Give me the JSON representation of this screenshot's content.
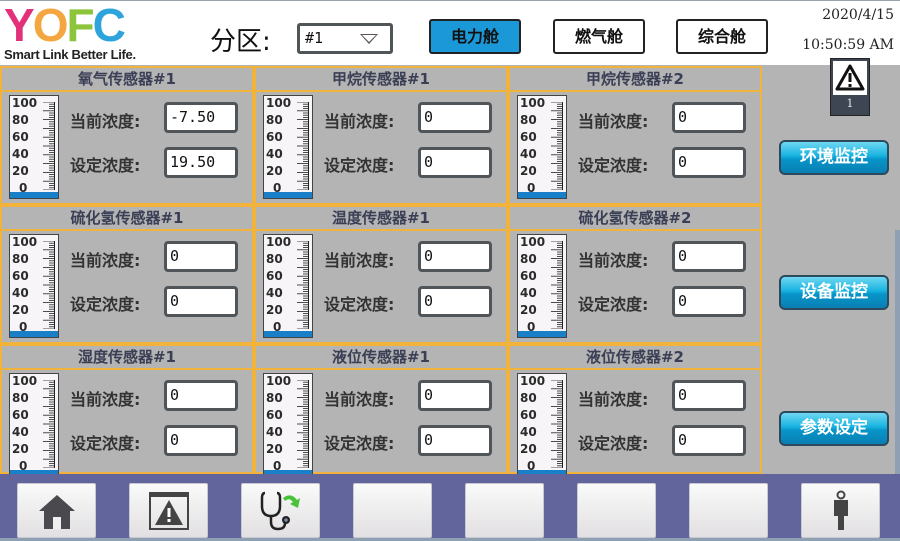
{
  "header": {
    "logo": {
      "letters": [
        {
          "char": "Y",
          "color": "#e2307a"
        },
        {
          "char": "O",
          "color": "#f4a640"
        },
        {
          "char": "F",
          "color": "#8cc43c"
        },
        {
          "char": "C",
          "color": "#2ea4dc"
        }
      ],
      "tagline": "Smart Link Better Life."
    },
    "zone_label": "分区:",
    "zone_select": {
      "value": "#1"
    },
    "cabins": [
      {
        "label": "电力舱",
        "active": true
      },
      {
        "label": "燃气舱",
        "active": false
      },
      {
        "label": "综合舱",
        "active": false
      }
    ],
    "date": "2020/4/15",
    "time": "10:50:59 AM",
    "alarm": {
      "icon": "warning-icon",
      "count": "1"
    }
  },
  "labels": {
    "current": "当前浓度:",
    "setpoint": "设定浓度:"
  },
  "gauge_scale": [
    "100",
    "80",
    "60",
    "40",
    "20",
    "0"
  ],
  "sensors": [
    {
      "title": "氧气传感器#1",
      "current": "-7.50",
      "setpoint": "19.50",
      "level_percent": 0
    },
    {
      "title": "甲烷传感器#1",
      "current": "0",
      "setpoint": "0",
      "level_percent": 0
    },
    {
      "title": "甲烷传感器#2",
      "current": "0",
      "setpoint": "0",
      "level_percent": 0
    },
    {
      "title": "硫化氢传感器#1",
      "current": "0",
      "setpoint": "0",
      "level_percent": 0
    },
    {
      "title": "温度传感器#1",
      "current": "0",
      "setpoint": "0",
      "level_percent": 0
    },
    {
      "title": "硫化氢传感器#2",
      "current": "0",
      "setpoint": "0",
      "level_percent": 0
    },
    {
      "title": "湿度传感器#1",
      "current": "0",
      "setpoint": "0",
      "level_percent": 0
    },
    {
      "title": "液位传感器#1",
      "current": "0",
      "setpoint": "0",
      "level_percent": 0
    },
    {
      "title": "液位传感器#2",
      "current": "0",
      "setpoint": "0",
      "level_percent": 0
    }
  ],
  "side_nav": [
    {
      "label": "环境监控"
    },
    {
      "label": "设备监控"
    },
    {
      "label": "参数设定"
    }
  ],
  "toolbar": [
    {
      "icon": "home-icon"
    },
    {
      "icon": "alarm-window-icon"
    },
    {
      "icon": "stethoscope-icon"
    },
    {
      "icon": ""
    },
    {
      "icon": ""
    },
    {
      "icon": ""
    },
    {
      "icon": ""
    },
    {
      "icon": "user-icon"
    }
  ],
  "colors": {
    "accent": "#1a98d8",
    "grid_border": "#f2b33d",
    "gauge_fill": "#1a7fc9",
    "toolbar_bg": "#62649c",
    "panel_bg": "#b4b4b4"
  }
}
